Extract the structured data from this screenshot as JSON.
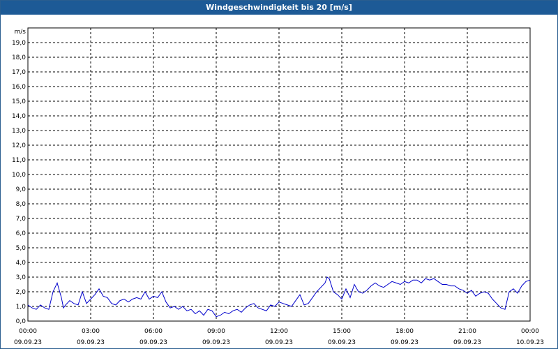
{
  "window": {
    "title": "Windgeschwindigkeit bis 20 [m/s]"
  },
  "chart_data": {
    "type": "line",
    "title": "Windgeschwindigkeit bis 20 [m/s]",
    "ylabel": "m/s",
    "xlabel": "",
    "ylim": [
      0,
      20
    ],
    "xlim_hours": [
      0,
      24
    ],
    "grid": true,
    "line_color": "#0000cc",
    "y_ticks": [
      "0,0",
      "1,0",
      "2,0",
      "3,0",
      "4,0",
      "5,0",
      "6,0",
      "7,0",
      "8,0",
      "9,0",
      "10,0",
      "11,0",
      "12,0",
      "13,0",
      "14,0",
      "15,0",
      "16,0",
      "17,0",
      "18,0",
      "19,0"
    ],
    "x_ticks": [
      {
        "time": "00:00",
        "date": "09.09.23"
      },
      {
        "time": "03:00",
        "date": "09.09.23"
      },
      {
        "time": "06:00",
        "date": "09.09.23"
      },
      {
        "time": "09:00",
        "date": "09.09.23"
      },
      {
        "time": "12:00",
        "date": "09.09.23"
      },
      {
        "time": "15:00",
        "date": "09.09.23"
      },
      {
        "time": "18:00",
        "date": "09.09.23"
      },
      {
        "time": "21:00",
        "date": "09.09.23"
      },
      {
        "time": "00:00",
        "date": "10.09.23"
      }
    ],
    "series": [
      {
        "x_hours": [
          0.0,
          0.2,
          0.4,
          0.6,
          0.8,
          1.0,
          1.2,
          1.4,
          1.6,
          1.7,
          1.8,
          2.0,
          2.2,
          2.4,
          2.6,
          2.8,
          3.0,
          3.2,
          3.4,
          3.6,
          3.8,
          4.0,
          4.2,
          4.4,
          4.6,
          4.8,
          5.0,
          5.2,
          5.4,
          5.6,
          5.8,
          6.0,
          6.2,
          6.4,
          6.6,
          6.8,
          7.0,
          7.2,
          7.4,
          7.6,
          7.8,
          8.0,
          8.2,
          8.4,
          8.6,
          8.8,
          9.0,
          9.2,
          9.4,
          9.6,
          9.8,
          10.0,
          10.2,
          10.4,
          10.6,
          10.8,
          11.0,
          11.2,
          11.4,
          11.6,
          11.8,
          12.0,
          12.2,
          12.4,
          12.6,
          12.8,
          13.0,
          13.2,
          13.4,
          13.6,
          13.8,
          14.0,
          14.2,
          14.3,
          14.4,
          14.6,
          14.8,
          15.0,
          15.2,
          15.4,
          15.6,
          15.8,
          16.0,
          16.2,
          16.4,
          16.6,
          16.8,
          17.0,
          17.2,
          17.4,
          17.6,
          17.8,
          18.0,
          18.2,
          18.4,
          18.6,
          18.8,
          19.0,
          19.2,
          19.4,
          19.6,
          19.8,
          20.0,
          20.2,
          20.4,
          20.6,
          20.8,
          21.0,
          21.2,
          21.4,
          21.6,
          21.8,
          22.0,
          22.2,
          22.4,
          22.6,
          22.8,
          23.0,
          23.2,
          23.4,
          23.6,
          23.8,
          24.0
        ],
        "values": [
          1.1,
          0.9,
          0.8,
          1.1,
          0.9,
          0.8,
          2.0,
          2.6,
          1.6,
          0.9,
          1.1,
          1.4,
          1.2,
          1.1,
          2.0,
          1.2,
          1.5,
          1.8,
          2.2,
          1.7,
          1.6,
          1.2,
          1.1,
          1.4,
          1.5,
          1.3,
          1.5,
          1.6,
          1.5,
          2.0,
          1.5,
          1.7,
          1.6,
          2.0,
          1.3,
          0.9,
          1.0,
          0.8,
          1.0,
          0.7,
          0.8,
          0.5,
          0.7,
          0.4,
          0.8,
          0.7,
          0.3,
          0.4,
          0.6,
          0.5,
          0.7,
          0.8,
          0.6,
          0.9,
          1.1,
          1.2,
          0.9,
          0.8,
          0.7,
          1.1,
          1.0,
          1.3,
          1.2,
          1.1,
          1.0,
          1.4,
          1.8,
          1.1,
          1.2,
          1.6,
          2.0,
          2.3,
          2.6,
          3.0,
          2.9,
          2.0,
          1.8,
          1.5,
          2.2,
          1.6,
          2.5,
          2.0,
          1.9,
          2.1,
          2.4,
          2.6,
          2.4,
          2.3,
          2.5,
          2.7,
          2.6,
          2.5,
          2.7,
          2.6,
          2.8,
          2.8,
          2.6,
          2.9,
          2.8,
          2.9,
          2.7,
          2.5,
          2.5,
          2.4,
          2.4,
          2.2,
          2.1,
          1.9,
          2.1,
          1.7,
          1.9,
          2.0,
          1.9,
          1.5,
          1.2,
          0.9,
          0.8,
          2.0,
          2.2,
          1.9,
          2.4,
          2.7,
          2.8,
          2.7,
          3.0,
          3.1,
          3.2
        ]
      }
    ]
  }
}
